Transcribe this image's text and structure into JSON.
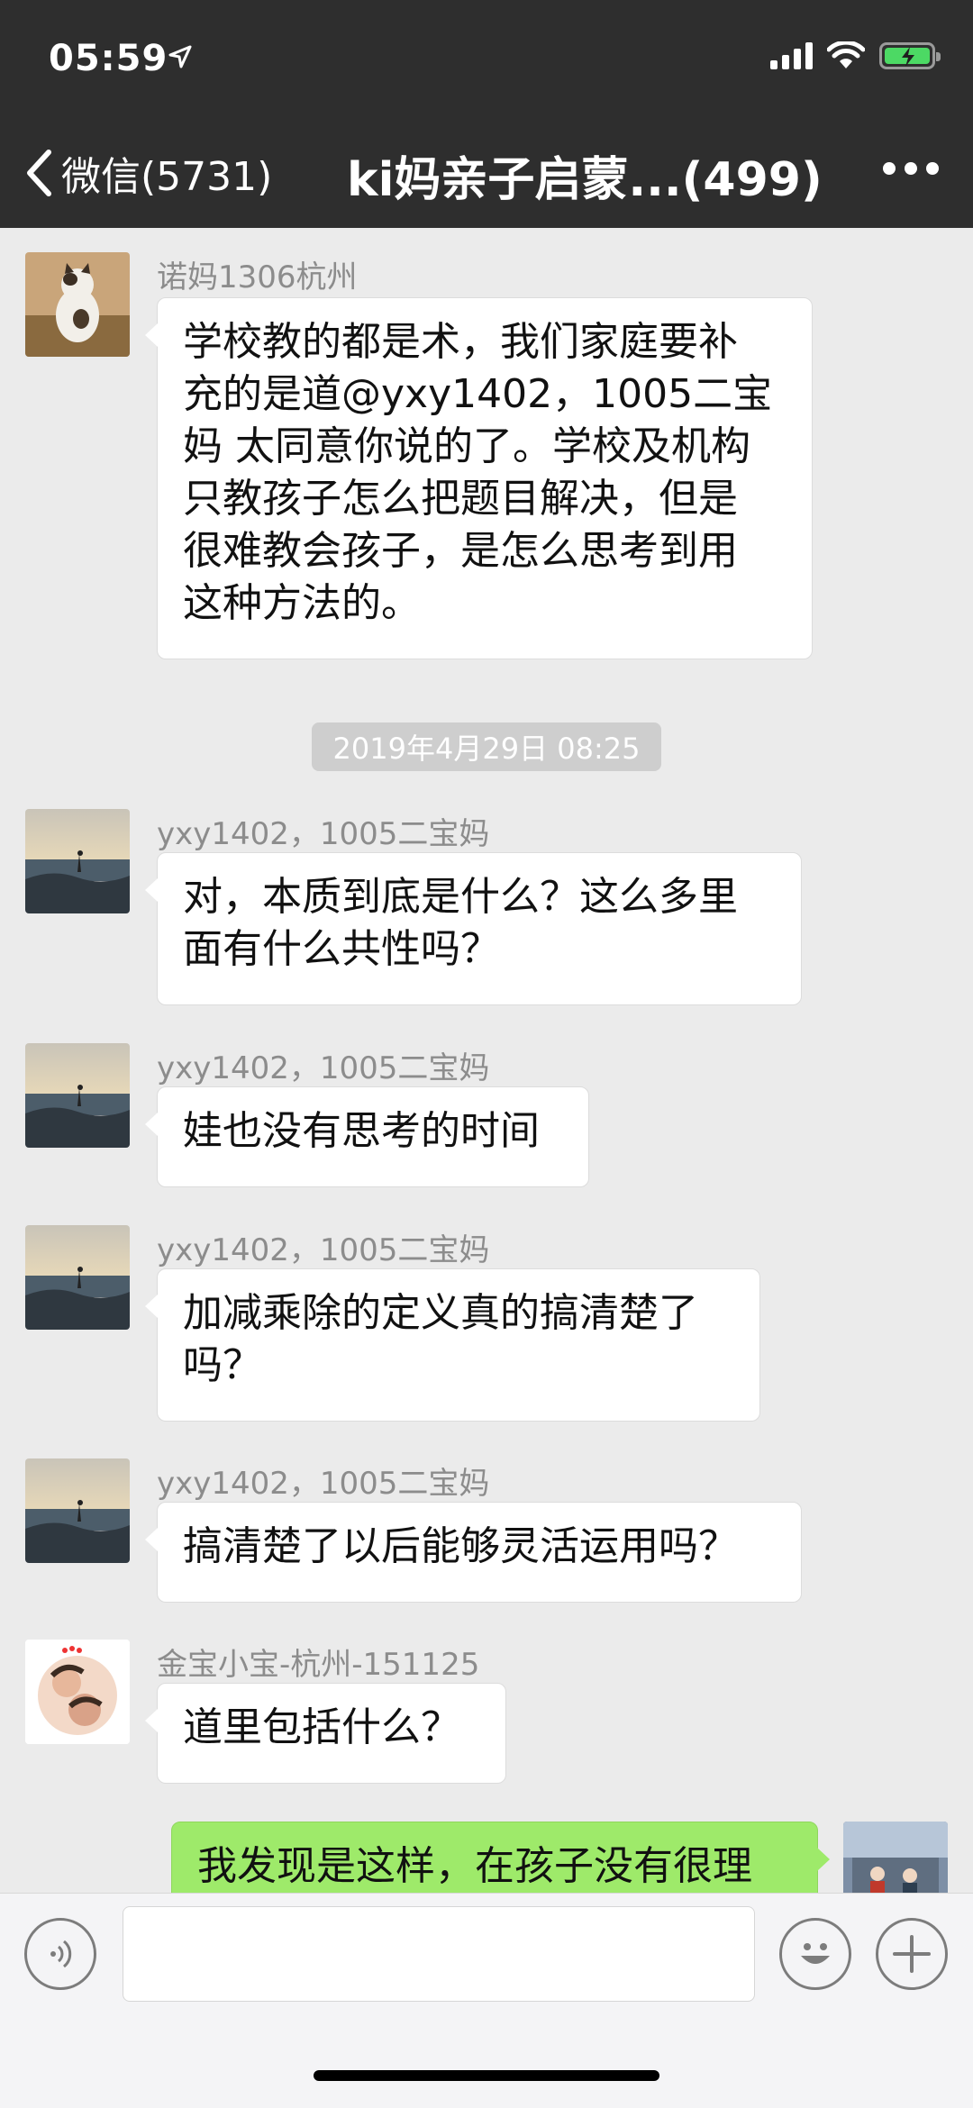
{
  "status_bar": {
    "time": "05:59"
  },
  "nav": {
    "back_label": "微信(5731)",
    "title": "ki妈亲子启蒙...(499)"
  },
  "messages": [
    {
      "sender": "诺妈1306杭州",
      "lines": [
        "学校教的都是术，我们家庭要补",
        "充的是道@yxy1402，1005二宝",
        "妈 太同意你说的了。学校及机构",
        "只教孩子怎么把题目解决，但是",
        "很难教会孩子，是怎么思考到用",
        "这种方法的。"
      ]
    },
    {
      "sender": "yxy1402，1005二宝妈",
      "lines": [
        "对，本质到底是什么？这么多里",
        "面有什么共性吗？"
      ]
    },
    {
      "sender": "yxy1402，1005二宝妈",
      "lines": [
        "娃也没有思考的时间"
      ]
    },
    {
      "sender": "yxy1402，1005二宝妈",
      "lines": [
        "加减乘除的定义真的搞清楚了",
        "吗？"
      ]
    },
    {
      "sender": "yxy1402，1005二宝妈",
      "lines": [
        "搞清楚了以后能够灵活运用吗？"
      ]
    },
    {
      "sender": "金宝小宝-杭州-151125",
      "lines": [
        "道里包括什么？"
      ]
    },
    {
      "sender": "",
      "lines": [
        "我发现是这样，在孩子没有很理"
      ]
    }
  ],
  "timestamp": "2019年4月29日 08:25",
  "colors": {
    "header": "#2e2e2e",
    "chat_bg": "#ebebeb",
    "my_bubble": "#9eea6a",
    "battery": "#4cd964"
  }
}
